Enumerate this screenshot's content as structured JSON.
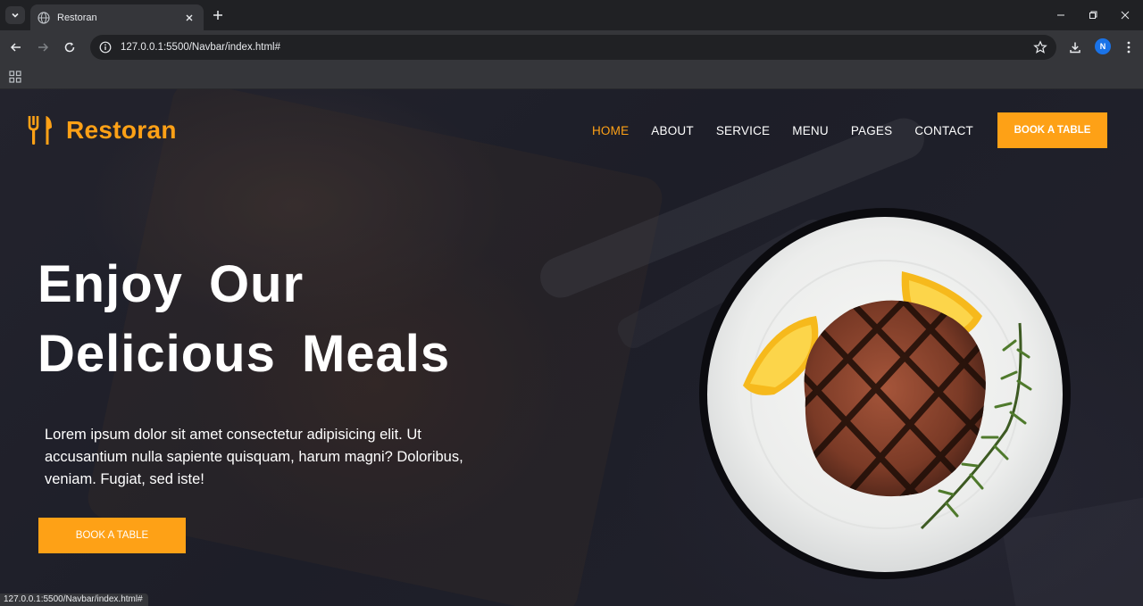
{
  "browser": {
    "tab_title": "Restoran",
    "url": "127.0.0.1:5500/Navbar/index.html#",
    "profile_initial": "N",
    "status_url": "127.0.0.1:5500/Navbar/index.html#"
  },
  "site": {
    "brand": "Restoran",
    "nav": [
      {
        "label": "HOME",
        "active": true
      },
      {
        "label": "ABOUT"
      },
      {
        "label": "SERVICE"
      },
      {
        "label": "MENU"
      },
      {
        "label": "PAGES"
      },
      {
        "label": "CONTACT"
      }
    ],
    "cta_top": "BOOK A TABLE",
    "hero": {
      "title_line1": "Enjoy Our",
      "title_line2": "Delicious Meals",
      "text": "Lorem ipsum dolor sit amet consectetur adipisicing elit. Ut accusantium nulla sapiente quisquam, harum magni? Doloribus, veniam. Fugiat, sed iste!",
      "cta": "BOOK A TABLE"
    }
  },
  "colors": {
    "accent": "#fea116",
    "background": "#1e1f29",
    "text": "#ffffff"
  }
}
